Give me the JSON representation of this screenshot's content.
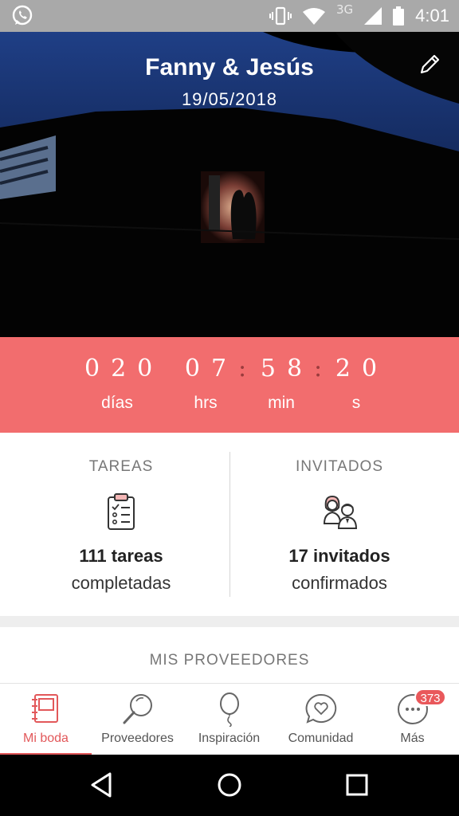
{
  "status_bar": {
    "network": "3G",
    "time": "4:01",
    "icons": [
      "whatsapp-icon",
      "vibrate-icon",
      "wifi-icon",
      "signal-icon",
      "battery-icon"
    ]
  },
  "hero": {
    "couple": "Fanny & Jesús",
    "date": "19/05/2018"
  },
  "countdown": {
    "days": "020",
    "hours": "07",
    "minutes": "58",
    "seconds": "20",
    "days_label": "días",
    "hours_label": "hrs",
    "minutes_label": "min",
    "seconds_label": "s"
  },
  "stats": {
    "tasks": {
      "heading": "TAREAS",
      "count": "111 tareas",
      "sub": "completadas"
    },
    "guests": {
      "heading": "INVITADOS",
      "count": "17 invitados",
      "sub": "confirmados"
    }
  },
  "vendors": {
    "title": "MIS PROVEEDORES"
  },
  "bottom_nav": {
    "items": [
      {
        "label": "Mi boda",
        "icon": "notebook-icon"
      },
      {
        "label": "Proveedores",
        "icon": "magnifier-icon"
      },
      {
        "label": "Inspiración",
        "icon": "balloon-icon"
      },
      {
        "label": "Comunidad",
        "icon": "heart-chat-icon"
      },
      {
        "label": "Más",
        "icon": "more-icon"
      }
    ],
    "badge": "373"
  },
  "colors": {
    "accent": "#f26d6e",
    "active": "#e2585a",
    "status_bar": "#a9a9a9"
  }
}
